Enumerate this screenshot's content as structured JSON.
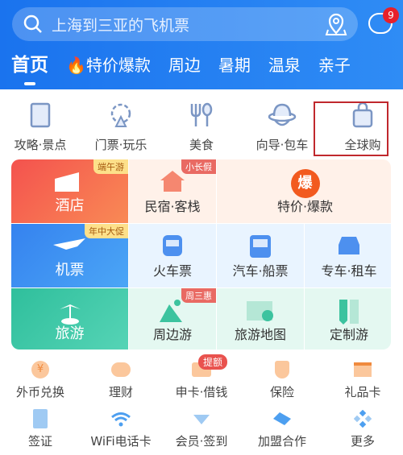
{
  "header": {
    "search_placeholder": "上海到三亚的飞机票",
    "message_badge": "9",
    "tabs": [
      {
        "label": "首页",
        "active": true
      },
      {
        "label": "特价爆款",
        "icon": "fire-icon"
      },
      {
        "label": "周边"
      },
      {
        "label": "暑期"
      },
      {
        "label": "温泉"
      },
      {
        "label": "亲子"
      }
    ]
  },
  "quick": [
    {
      "label": "攻略·景点",
      "icon": "book-icon"
    },
    {
      "label": "门票·玩乐",
      "icon": "ferris-wheel-icon"
    },
    {
      "label": "美食",
      "icon": "fork-spoon-icon"
    },
    {
      "label": "向导·包车",
      "icon": "guide-hat-icon"
    },
    {
      "label": "全球购",
      "icon": "shopping-bag-icon",
      "highlighted": true
    }
  ],
  "grid": [
    {
      "label": "酒店",
      "tag": "端午游",
      "icon": "hotel-icon"
    },
    {
      "label": "民宿·客栈",
      "tag": "小长假",
      "icon": "house-icon"
    },
    {
      "label": "特价·爆款",
      "icon": "hot-deal-icon",
      "icon_text": "爆"
    },
    {
      "label": "机票",
      "tag": "年中大促",
      "icon": "plane-icon"
    },
    {
      "label": "火车票",
      "icon": "train-icon"
    },
    {
      "label": "汽车·船票",
      "icon": "bus-icon"
    },
    {
      "label": "专车·租车",
      "icon": "car-icon"
    },
    {
      "label": "旅游",
      "icon": "palm-tree-icon"
    },
    {
      "label": "周边游",
      "tag": "周三惠",
      "icon": "mountain-icon"
    },
    {
      "label": "旅游地图",
      "icon": "map-icon"
    },
    {
      "label": "定制游",
      "icon": "ruler-pen-icon"
    }
  ],
  "services1": [
    {
      "label": "外币兑换",
      "icon": "yuan-coin-icon"
    },
    {
      "label": "理财",
      "icon": "piggy-bank-icon"
    },
    {
      "label": "申卡·借钱",
      "icon": "card-icon",
      "tag": "提额"
    },
    {
      "label": "保险",
      "icon": "shield-icon"
    },
    {
      "label": "礼品卡",
      "icon": "gift-icon"
    }
  ],
  "services2": [
    {
      "label": "签证",
      "icon": "passport-icon"
    },
    {
      "label": "WiFi电话卡",
      "icon": "wifi-icon"
    },
    {
      "label": "会员·签到",
      "icon": "diamond-icon"
    },
    {
      "label": "加盟合作",
      "icon": "handshake-icon"
    },
    {
      "label": "更多",
      "icon": "more-icon"
    }
  ],
  "colors": {
    "header": "#1a73ee",
    "hotel": "#f56a4e",
    "flight": "#3d8ff2",
    "travel": "#3cc6a8",
    "highlight": "#c0282d"
  }
}
